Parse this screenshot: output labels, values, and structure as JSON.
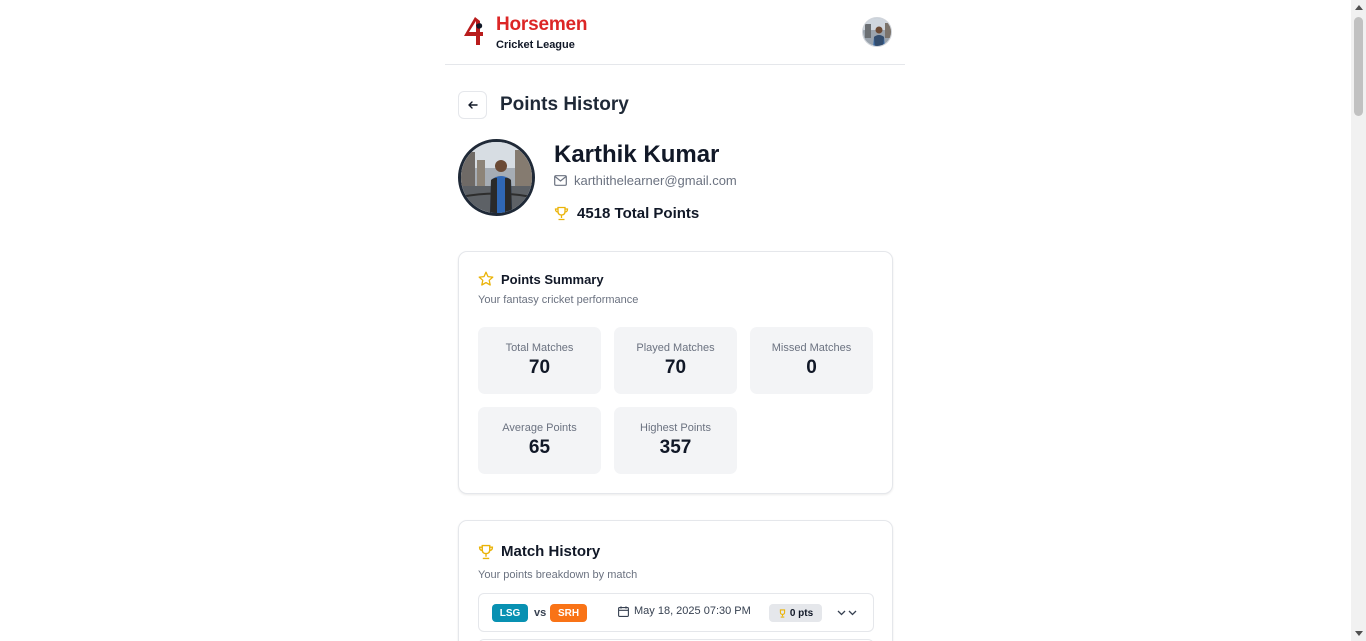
{
  "header": {
    "brand_title": "Horsemen",
    "brand_subtitle": "Cricket League",
    "logo_icon": "horse-four-logo",
    "avatar_icon": "user-avatar"
  },
  "page": {
    "title": "Points History",
    "back_icon": "arrow-left-icon"
  },
  "profile": {
    "name": "Karthik Kumar",
    "email": "karthithelearner@gmail.com",
    "total_points": "4518 Total Points"
  },
  "summary": {
    "title": "Points Summary",
    "description": "Your fantasy cricket performance",
    "stats": [
      {
        "label": "Total Matches",
        "value": "70"
      },
      {
        "label": "Played Matches",
        "value": "70"
      },
      {
        "label": "Missed Matches",
        "value": "0"
      },
      {
        "label": "Average Points",
        "value": "65"
      },
      {
        "label": "Highest Points",
        "value": "357"
      }
    ]
  },
  "history": {
    "title": "Match History",
    "description": "Your points breakdown by match",
    "matches": [
      {
        "team_a": "LSG",
        "vs": "vs",
        "team_b": "SRH",
        "date": "May 18, 2025 07:30 PM",
        "points": "0 pts"
      }
    ]
  },
  "colors": {
    "brand_red": "#dc2626",
    "trophy_gold": "#eab308",
    "lsg_teal": "#0891b2",
    "srh_orange": "#f97316",
    "stat_bg": "#f3f4f6"
  }
}
